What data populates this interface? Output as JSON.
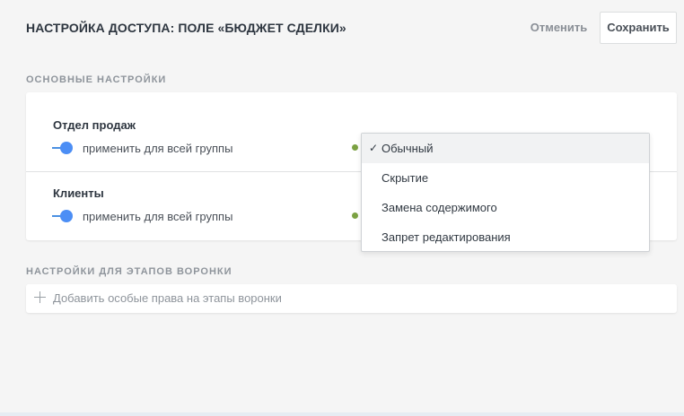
{
  "header": {
    "title": "НАСТРОЙКА ДОСТУПА: ПОЛЕ «БЮДЖЕТ СДЕЛКИ»",
    "cancel_label": "Отменить",
    "save_label": "Сохранить"
  },
  "main_settings": {
    "section_label": "ОСНОВНЫЕ НАСТРОЙКИ",
    "groups": [
      {
        "name": "Отдел продаж",
        "toggle_label": "применить для всей группы",
        "toggle_on": true
      },
      {
        "name": "Клиенты",
        "toggle_label": "применить для всей группы",
        "toggle_on": true
      }
    ]
  },
  "dropdown": {
    "options": [
      {
        "label": "Обычный",
        "selected": true
      },
      {
        "label": "Скрытие",
        "selected": false
      },
      {
        "label": "Замена содержимого",
        "selected": false
      },
      {
        "label": "Запрет редактирования",
        "selected": false
      }
    ],
    "check_glyph": "✓"
  },
  "pipeline_settings": {
    "section_label": "НАСТРОЙКИ ДЛЯ ЭТАПОВ ВОРОНКИ",
    "add_label": "Добавить особые права на этапы воронки"
  },
  "colors": {
    "accent": "#4c8ef5",
    "status_dot": "#7ba142",
    "background": "#f5f5f5"
  },
  "icons": {
    "check": "check-icon",
    "plus": "plus-icon"
  }
}
